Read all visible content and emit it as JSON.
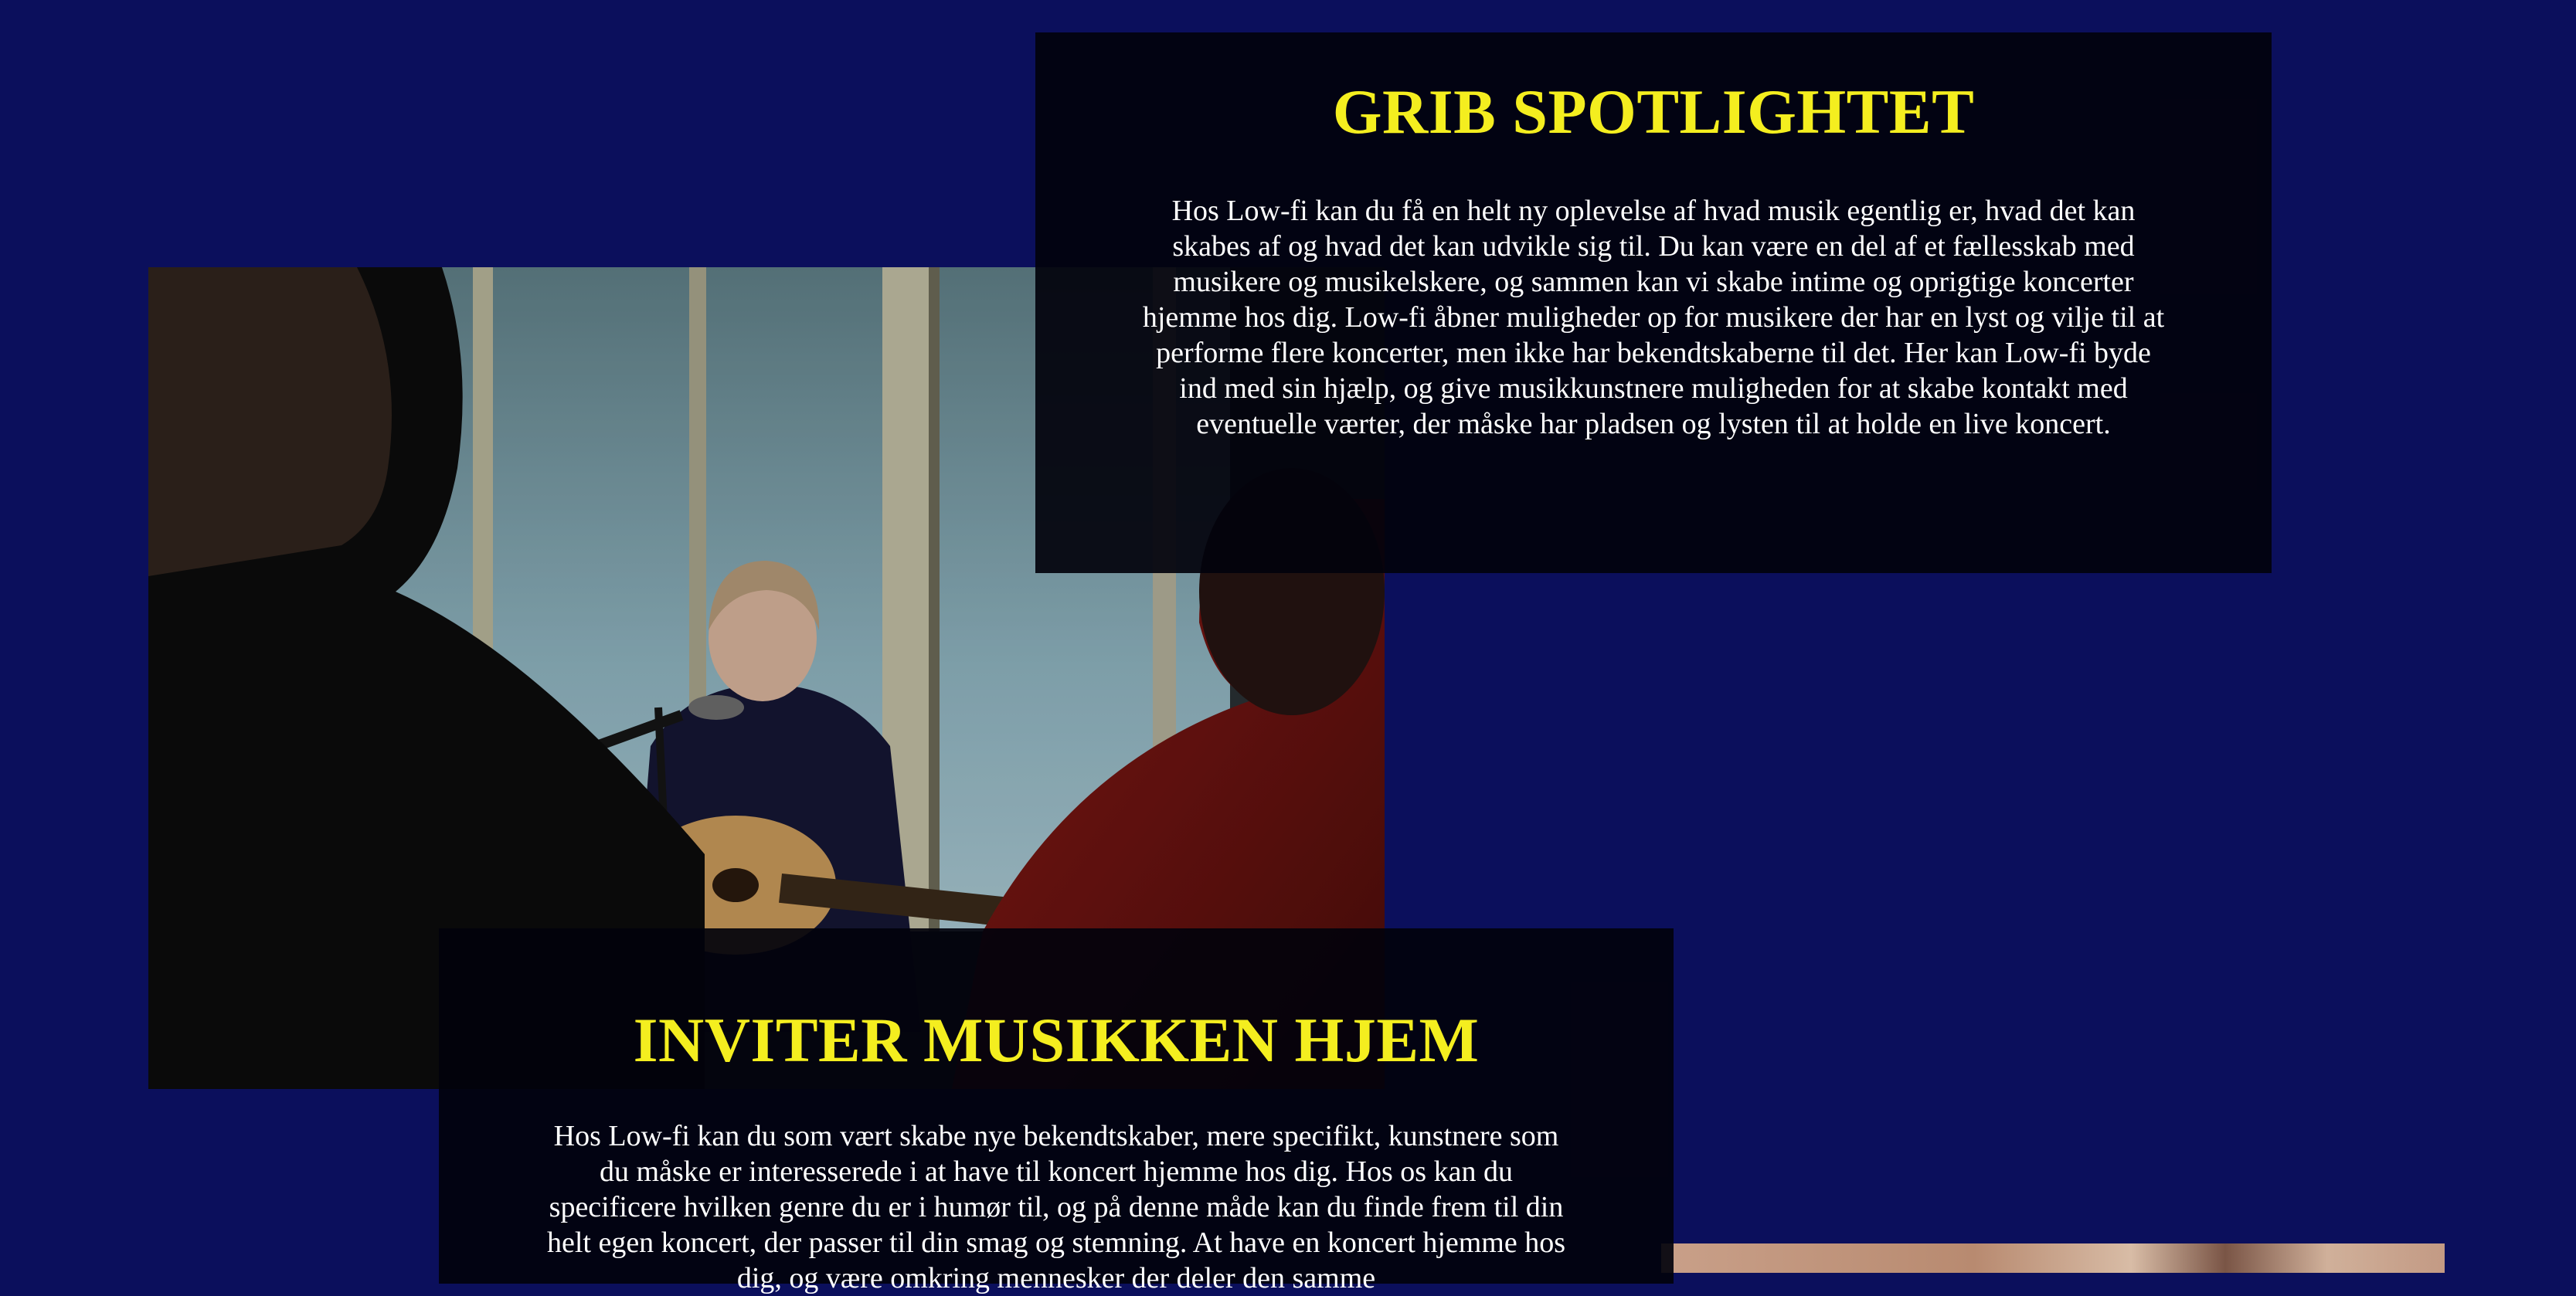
{
  "sections": [
    {
      "heading": "GRIB SPOTLIGHTET",
      "body": "Hos Low-fi kan du få en helt ny oplevelse af hvad musik egentlig er, hvad det kan skabes af og hvad det kan udvikle sig til. Du kan være en del af et fællesskab med musikere og musikelskere, og sammen kan vi skabe intime og oprigtige koncerter hjemme hos dig. Low-fi åbner muligheder op for musikere der har en lyst og vilje til at performe flere koncerter, men ikke har bekendtskaberne til det. Her kan Low-fi byde ind med sin hjælp, og give musikkunstnere muligheden for at skabe kontakt med eventuelle værter, der måske har pladsen og lysten til at holde en live koncert."
    },
    {
      "heading": "INVITER MUSIKKEN HJEM",
      "body": "Hos Low-fi kan du som vært skabe nye bekendtskaber, mere specifikt, kunstnere som du måske er interesserede i at have til koncert hjemme hos dig. Hos os kan du specificere hvilken genre du er i humør til, og på denne måde kan du finde frem til din helt egen koncert, der passer til din smag og stemning. At have en koncert hjemme hos dig, og være omkring mennesker der deler den samme"
    }
  ],
  "colors": {
    "background": "#0b0f5c",
    "panel": "#02020c",
    "heading": "#f4ee1f",
    "body_text": "#ffffff"
  }
}
